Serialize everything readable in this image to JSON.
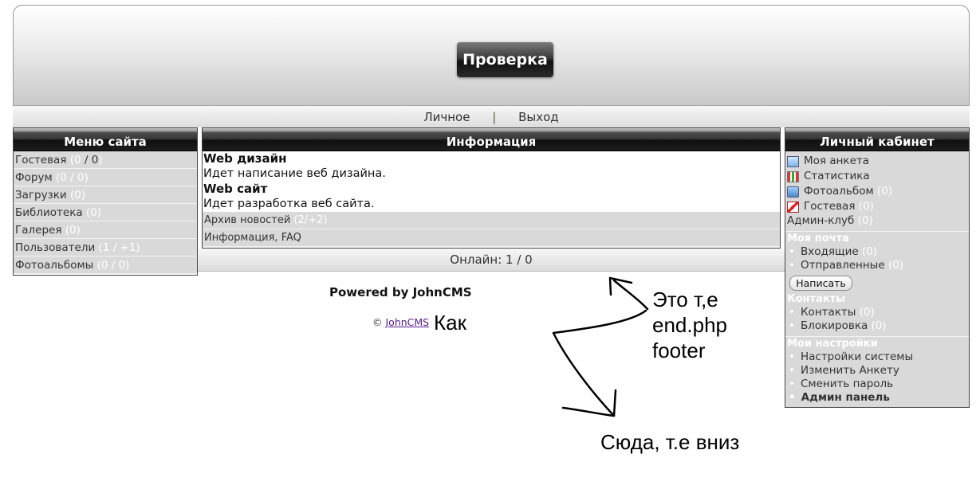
{
  "header": {
    "site_title": "Проверка"
  },
  "nav": {
    "personal": "Личное",
    "separator": "|",
    "logout": "Выход"
  },
  "left_menu": {
    "title": "Меню сайта",
    "items": [
      {
        "label": "Гостевая",
        "count_a": "(0",
        "count_slash": " / ",
        "count_b": "0",
        "count_close": ")"
      },
      {
        "label": "Форум",
        "count": "(0 / 0)"
      },
      {
        "label": "Загрузки",
        "count": "(0)"
      },
      {
        "label": "Библиотека",
        "count": "(0)"
      },
      {
        "label": "Галерея",
        "count": "(0)"
      },
      {
        "label": "Пользователи",
        "count": "(1 / +1)"
      },
      {
        "label": "Фотоальбомы",
        "count": "(0 / 0)"
      }
    ]
  },
  "info": {
    "title": "Информация",
    "news": [
      {
        "title": "Web дизайн",
        "text": "Идет написание веб дизайна."
      },
      {
        "title": "Web сайт",
        "text": "Идет разработка веб сайта."
      }
    ],
    "archive_label": "Архив новостей",
    "archive_count": "(2/+2)",
    "faq_label": "Информация, FAQ"
  },
  "online": {
    "text": "Онлайн: 1 / 0"
  },
  "cabinet": {
    "title": "Личный кабинет",
    "links": [
      {
        "label": "Моя анкета",
        "icon": "profile-icon",
        "count": ""
      },
      {
        "label": "Статистика",
        "icon": "stats-icon",
        "count": ""
      },
      {
        "label": "Фотоальбом",
        "icon": "photo-icon",
        "count": "(0)"
      },
      {
        "label": "Гостевая",
        "icon": "guestbook-icon",
        "count": "(0)"
      }
    ],
    "admin_club": "Админ-клуб",
    "admin_club_count": "(0)",
    "mail_heading": "Моя почта",
    "inbox": "Входящие",
    "inbox_count": "(0)",
    "sent": "Отправленные",
    "sent_count": "(0)",
    "write_button": "Написать",
    "contacts_heading": "Контакты",
    "contacts": "Контакты",
    "contacts_count": "(0)",
    "blocklist": "Блокировка",
    "blocklist_count": "(0)",
    "settings_heading": "Мои настройки",
    "settings": [
      "Настройки системы",
      "Изменить Анкету",
      "Сменить пароль"
    ],
    "admin_panel": "Админ панель"
  },
  "footer": {
    "powered": "Powered by JohnCMS",
    "copy_symbol": "©",
    "copy_link": "JohnCMS"
  },
  "annotations": {
    "kak": "Как",
    "eto_line1": "Это т,е",
    "eto_line2": "end.php",
    "eto_line3": "footer",
    "syuda": "Сюда, т.е вниз"
  }
}
